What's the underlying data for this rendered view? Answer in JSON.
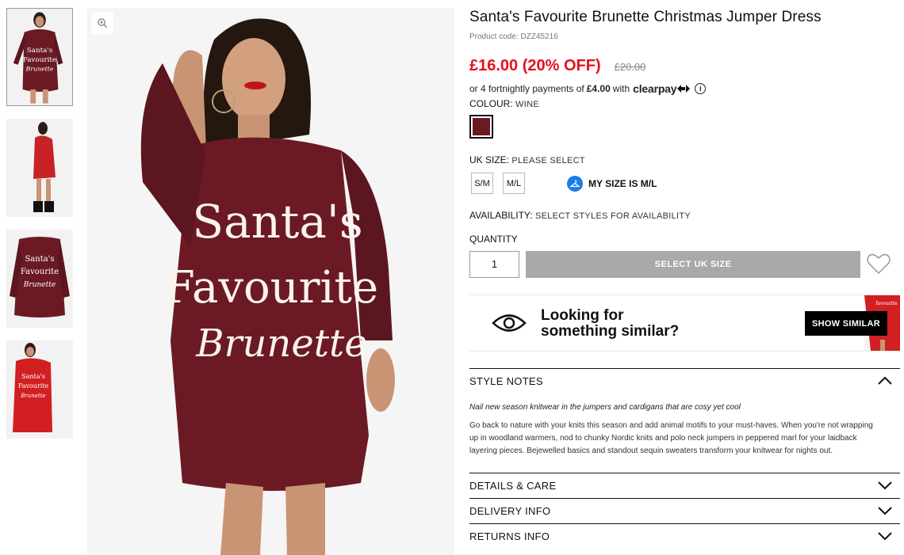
{
  "product": {
    "title": "Santa's Favourite Brunette Christmas Jumper Dress",
    "code": "Product code: DZZ45216",
    "price_now": "£16.00 (20% OFF)",
    "price_was": "£20.00"
  },
  "clearpay": {
    "prefix": "or 4 fortnightly payments of",
    "amount": "£4.00",
    "with": "with",
    "brand": "clearpay"
  },
  "colour": {
    "label": "COLOUR:",
    "value": "WINE",
    "swatch": "#6b1a24"
  },
  "size": {
    "label": "UK SIZE:",
    "value": "PLEASE SELECT",
    "options": [
      "S/M",
      "M/L"
    ],
    "my_size": "MY SIZE IS M/L"
  },
  "availability": {
    "label": "AVAILABILITY:",
    "value": "SELECT STYLES FOR AVAILABILITY"
  },
  "quantity": {
    "label": "QUANTITY",
    "value": "1"
  },
  "add_button": "SELECT UK SIZE",
  "similar": {
    "line1": "Looking for",
    "line2": "something similar?",
    "button": "SHOW SIMILAR"
  },
  "accordions": {
    "style_notes": {
      "title": "STYLE NOTES",
      "intro": "Nail new season knitwear in the jumpers and cardigans that are cosy yet cool",
      "body": "Go back to nature with your knits this season and add animal motifs to your must-haves. When you're not wrapping up in woodland warmers, nod to chunky Nordic knits and polo neck jumpers in peppered marl for your laidback layering pieces. Bejewelled basics and standout sequin sweaters transform your knitwear for nights out."
    },
    "details": "DETAILS & CARE",
    "delivery": "DELIVERY INFO",
    "returns": "RETURNS INFO"
  },
  "image_text": {
    "line1": "Santa's",
    "line2": "Favourite",
    "line3": "Brunette"
  },
  "colors": {
    "sale": "#e4101e",
    "wine": "#6b1a24",
    "button_grey": "#a9a9a9",
    "clearpay_blue": "#1a7ee6"
  }
}
